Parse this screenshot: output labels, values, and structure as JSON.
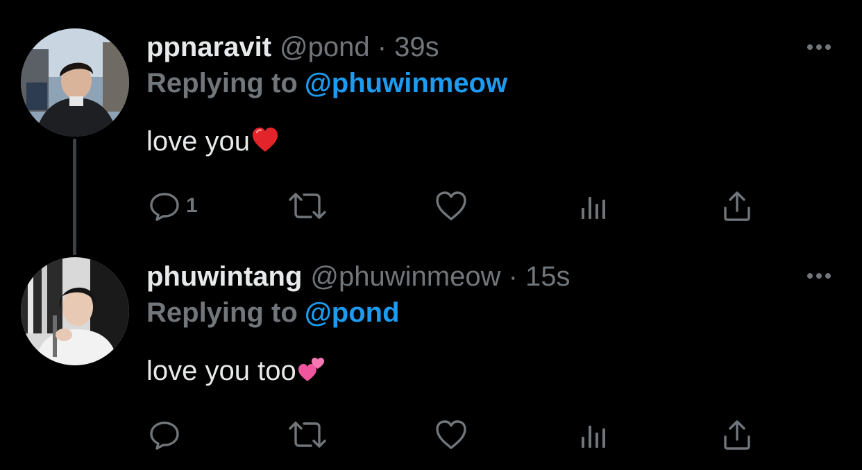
{
  "colors": {
    "background": "#000000",
    "primary_text": "#e7e9ea",
    "secondary_text": "#71767b",
    "accent": "#1d9bf0",
    "thread_line": "#3e4144"
  },
  "tweets": [
    {
      "display_name": "ppnaravit",
      "handle_time": "@pond · 39s",
      "replying_prefix": "Replying to",
      "replying_to": "@phuwinmeow",
      "text": "love you",
      "text_emoji": "red-heart-emoji",
      "reply_count": "1",
      "icons": [
        "reply-icon",
        "retweet-icon",
        "like-icon",
        "views-icon",
        "share-icon",
        "more-icon"
      ]
    },
    {
      "display_name": "phuwintang",
      "handle_time": "@phuwinmeow · 15s",
      "replying_prefix": "Replying to",
      "replying_to": "@pond",
      "text": "love you too",
      "text_emoji": "two-hearts-emoji",
      "reply_count": "",
      "icons": [
        "reply-icon",
        "retweet-icon",
        "like-icon",
        "views-icon",
        "share-icon",
        "more-icon"
      ]
    }
  ]
}
